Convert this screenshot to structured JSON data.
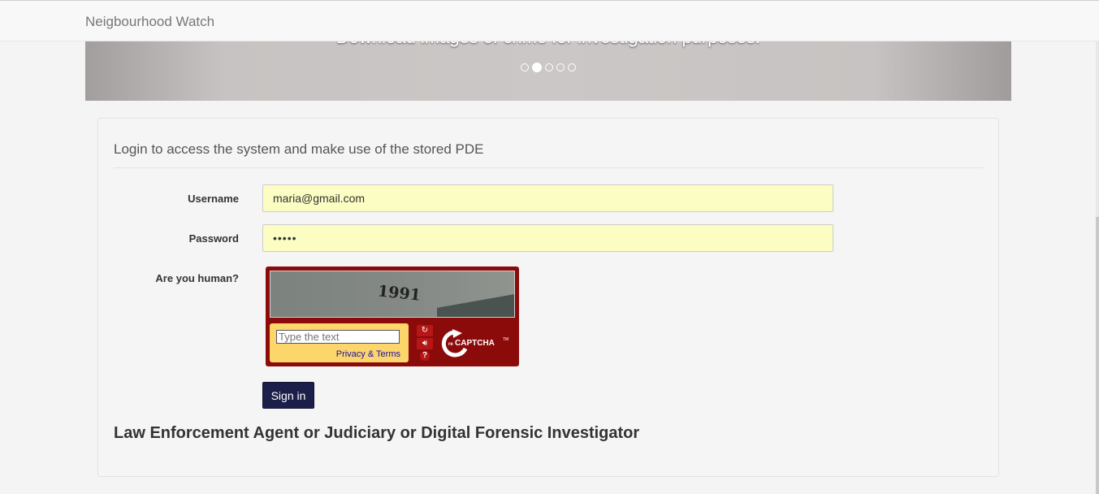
{
  "navbar": {
    "brand": "Neigbourhood Watch"
  },
  "carousel": {
    "caption": "Download images of crime for investigation purposes.",
    "slide_count": 5,
    "active_slide": 2
  },
  "login": {
    "heading": "Login to access the system and make use of the stored PDE",
    "username_label": "Username",
    "username_value": "maria@gmail.com",
    "password_label": "Password",
    "password_value": "•••••",
    "captcha_label": "Are you human?",
    "signin_label": "Sign in"
  },
  "captcha": {
    "challenge_text": "1991",
    "placeholder": "Type the text",
    "links": "Privacy & Terms",
    "brand": "reCAPTCHA",
    "refresh_icon": "refresh-icon",
    "audio_icon": "speaker-icon",
    "help_icon": "help-icon"
  },
  "footer": {
    "role_title": "Law Enforcement Agent or Judiciary or Digital Forensic Investigator"
  },
  "colors": {
    "captcha_border": "#8b0b0b",
    "captcha_input_bg": "#fcd56b",
    "signin_bg": "#1c1f4a",
    "autofill_bg": "#fbfdc2"
  }
}
